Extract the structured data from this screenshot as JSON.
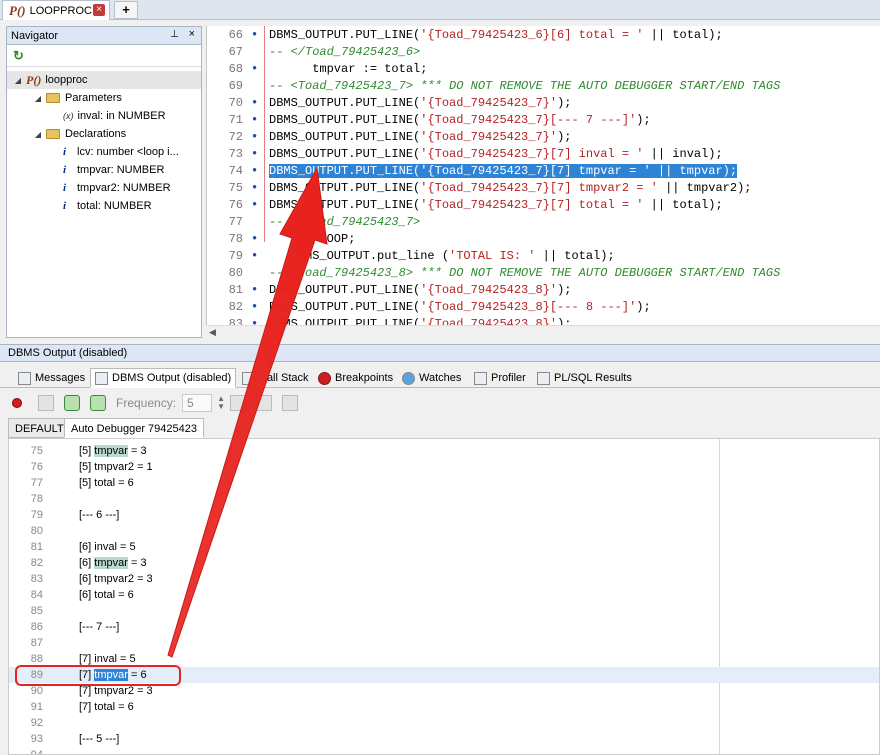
{
  "doc_tab": {
    "title": "LOOPPROC",
    "icon": "package-icon",
    "icon_text": "P()",
    "close": "×",
    "add": "+"
  },
  "navigator": {
    "title": "Navigator",
    "pin": "⊥",
    "close": "×",
    "tree": [
      {
        "label": "loopproc",
        "kind": "proc",
        "level": 0
      },
      {
        "label": "Parameters",
        "kind": "folder",
        "level": 1
      },
      {
        "label": "inval: in NUMBER",
        "kind": "param",
        "level": 2
      },
      {
        "label": "Declarations",
        "kind": "folder",
        "level": 1
      },
      {
        "label": "lcv: number <loop i...",
        "kind": "var",
        "level": 2
      },
      {
        "label": "tmpvar: NUMBER",
        "kind": "var",
        "level": 2
      },
      {
        "label": "tmpvar2: NUMBER",
        "kind": "var",
        "level": 2
      },
      {
        "label": "total: NUMBER",
        "kind": "var",
        "level": 2
      }
    ]
  },
  "editor": {
    "lines": [
      {
        "n": "66",
        "m": "•",
        "code": "DBMS_OUTPUT.PUT_LINE('{Toad_79425423_6}[6] total = ' || total);"
      },
      {
        "n": "67",
        "m": "",
        "code": "-- </Toad_79425423_6>"
      },
      {
        "n": "68",
        "m": "•",
        "code": "      tmpvar := total;"
      },
      {
        "n": "69",
        "m": "",
        "code": "-- <Toad_79425423_7> *** DO NOT REMOVE THE AUTO DEBUGGER START/END TAGS"
      },
      {
        "n": "70",
        "m": "•",
        "code": "DBMS_OUTPUT.PUT_LINE('{Toad_79425423_7}');"
      },
      {
        "n": "71",
        "m": "•",
        "code": "DBMS_OUTPUT.PUT_LINE('{Toad_79425423_7}[--- 7 ---]');"
      },
      {
        "n": "72",
        "m": "•",
        "code": "DBMS_OUTPUT.PUT_LINE('{Toad_79425423_7}');"
      },
      {
        "n": "73",
        "m": "•",
        "code": "DBMS_OUTPUT.PUT_LINE('{Toad_79425423_7}[7] inval = ' || inval);"
      },
      {
        "n": "74",
        "m": "•",
        "code": "DBMS_OUTPUT.PUT_LINE('{Toad_79425423_7}[7] tmpvar = ' || tmpvar);"
      },
      {
        "n": "75",
        "m": "•",
        "code": "DBMS_OUTPUT.PUT_LINE('{Toad_79425423_7}[7] tmpvar2 = ' || tmpvar2);"
      },
      {
        "n": "76",
        "m": "•",
        "code": "DBMS_OUTPUT.PUT_LINE('{Toad_79425423_7}[7] total = ' || total);"
      },
      {
        "n": "77",
        "m": "",
        "code": "-- </Toad_79425423_7>"
      },
      {
        "n": "78",
        "m": "•",
        "code": "   END LOOP;"
      },
      {
        "n": "79",
        "m": "•",
        "code": "   DBMS_OUTPUT.put_line ('TOTAL IS: ' || total);"
      },
      {
        "n": "80",
        "m": "",
        "code": "-- <Toad_79425423_8> *** DO NOT REMOVE THE AUTO DEBUGGER START/END TAGS"
      },
      {
        "n": "81",
        "m": "•",
        "code": "DBMS_OUTPUT.PUT_LINE('{Toad_79425423_8}');"
      },
      {
        "n": "82",
        "m": "•",
        "code": "DBMS_OUTPUT.PUT_LINE('{Toad_79425423_8}[--- 8 ---]');"
      },
      {
        "n": "83",
        "m": "•",
        "code": "DBMS_OUTPUT.PUT_LINE('{Toad_79425423_8}');"
      }
    ],
    "highlighted_line": "74"
  },
  "panel": {
    "title": "DBMS Output (disabled)",
    "tabs": [
      "Messages",
      "DBMS Output (disabled)",
      "Call Stack",
      "Breakpoints",
      "Watches",
      "Profiler",
      "PL/SQL Results"
    ],
    "frequency_label": "Frequency:",
    "frequency_value": "5",
    "subtabs": [
      "DEFAULT",
      "Auto Debugger 79425423"
    ]
  },
  "output": {
    "lines": [
      {
        "n": "75",
        "pre": "[5] ",
        "tag": "tmpvar",
        "post": " = 3"
      },
      {
        "n": "76",
        "pre": "[5] tmpvar2 = 1",
        "tag": "",
        "post": ""
      },
      {
        "n": "77",
        "pre": "[5] total = 6",
        "tag": "",
        "post": ""
      },
      {
        "n": "78",
        "pre": "",
        "tag": "",
        "post": ""
      },
      {
        "n": "79",
        "pre": "[--- 6 ---]",
        "tag": "",
        "post": ""
      },
      {
        "n": "80",
        "pre": "",
        "tag": "",
        "post": ""
      },
      {
        "n": "81",
        "pre": "[6] inval = 5",
        "tag": "",
        "post": ""
      },
      {
        "n": "82",
        "pre": "[6] ",
        "tag": "tmpvar",
        "post": " = 3"
      },
      {
        "n": "83",
        "pre": "[6] tmpvar2 = 3",
        "tag": "",
        "post": ""
      },
      {
        "n": "84",
        "pre": "[6] total = 6",
        "tag": "",
        "post": ""
      },
      {
        "n": "85",
        "pre": "",
        "tag": "",
        "post": ""
      },
      {
        "n": "86",
        "pre": "[--- 7 ---]",
        "tag": "",
        "post": ""
      },
      {
        "n": "87",
        "pre": "",
        "tag": "",
        "post": ""
      },
      {
        "n": "88",
        "pre": "[7] inval = 5",
        "tag": "",
        "post": ""
      },
      {
        "n": "89",
        "pre": "[7] ",
        "tag": "tmpvar",
        "post": " = 6",
        "current": true
      },
      {
        "n": "90",
        "pre": "[7] tmpvar2 = 3",
        "tag": "",
        "post": ""
      },
      {
        "n": "91",
        "pre": "[7] total = 6",
        "tag": "",
        "post": ""
      },
      {
        "n": "92",
        "pre": "",
        "tag": "",
        "post": ""
      },
      {
        "n": "93",
        "pre": "[--- 5 ---]",
        "tag": "",
        "post": ""
      },
      {
        "n": "94",
        "pre": "",
        "tag": "",
        "post": ""
      }
    ]
  },
  "colors": {
    "annotation": "#e8231f",
    "selection": "#2d83d6",
    "comment": "#2f8a2f",
    "string": "#b52222"
  }
}
